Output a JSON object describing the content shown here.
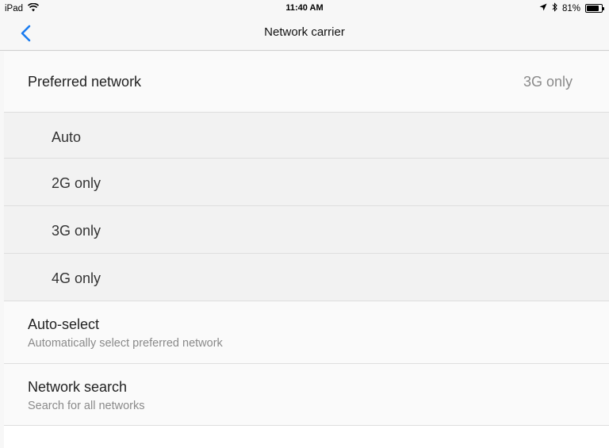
{
  "status_bar": {
    "device": "iPad",
    "time": "11:40 AM",
    "battery_percent_label": "81%",
    "battery_level": 0.81,
    "icons": [
      "wifi-icon",
      "location-arrow-icon",
      "bluetooth-icon",
      "battery-icon"
    ]
  },
  "nav": {
    "title": "Network carrier",
    "back_icon": "chevron-left-icon",
    "accent_color": "#1a7cf0"
  },
  "preferred": {
    "label": "Preferred network",
    "value": "3G only"
  },
  "options": [
    {
      "label": "Auto"
    },
    {
      "label": "2G only"
    },
    {
      "label": "3G only"
    },
    {
      "label": "4G only"
    }
  ],
  "auto_select": {
    "title": "Auto-select",
    "subtitle": "Automatically select preferred network"
  },
  "network_search": {
    "title": "Network search",
    "subtitle": "Search for all networks"
  }
}
